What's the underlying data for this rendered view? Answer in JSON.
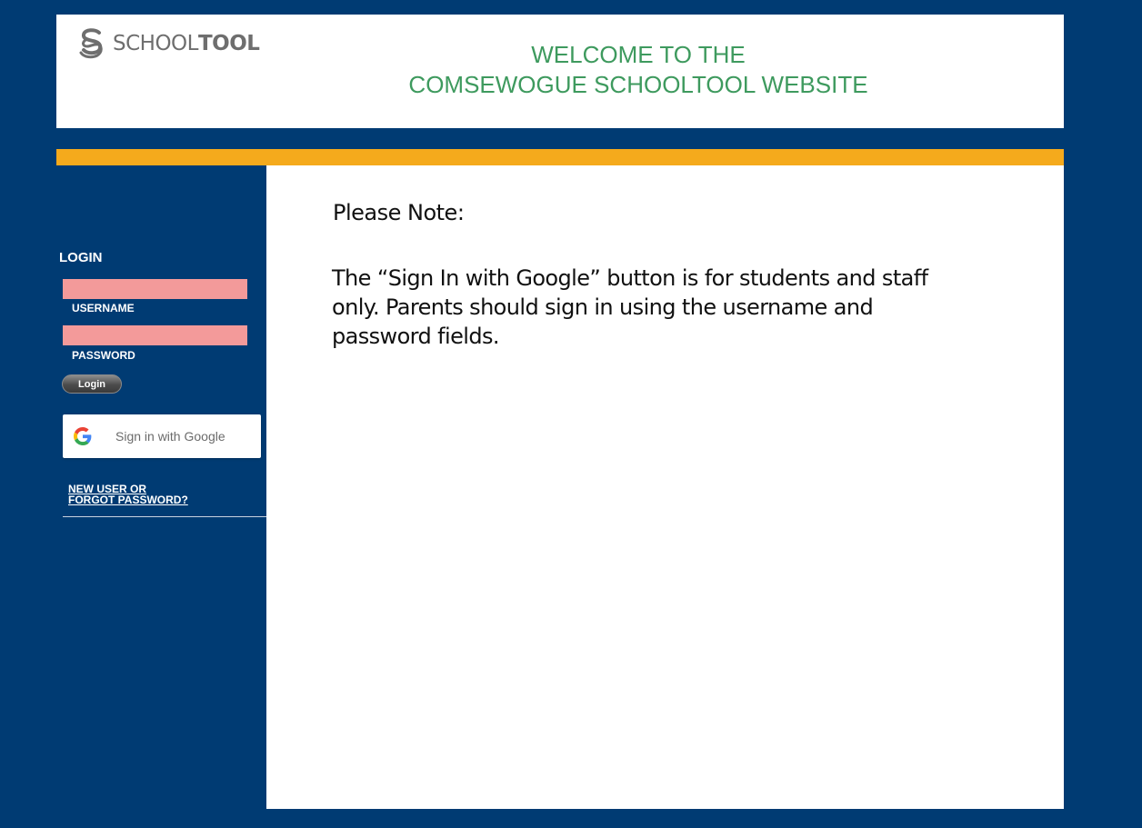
{
  "header": {
    "logo_text_light": "SCHOOL",
    "logo_text_bold": "TOOL",
    "welcome_line1": "WELCOME TO THE",
    "welcome_line2": "COMSEWOGUE SCHOOLTOOL WEBSITE"
  },
  "sidebar": {
    "login_title": "LOGIN",
    "username_label": "USERNAME",
    "username_value": "",
    "password_label": "PASSWORD",
    "password_value": "",
    "login_button": "Login",
    "google_button": "Sign in with Google",
    "new_user_line1": "NEW USER OR",
    "new_user_line2": "FORGOT PASSWORD?"
  },
  "content": {
    "note_title": "Please Note:",
    "note_line1": "The “Sign In with Google” button is for students and staff",
    "note_line2": "only. Parents should sign in using the username and",
    "note_line3": "password fields."
  },
  "colors": {
    "navy": "#003b73",
    "gold": "#f5aa1c",
    "welcome_green": "#3e9a5e",
    "field_pink": "#f39a9a"
  },
  "icons": {
    "logo": "schooltool-s-logo-icon",
    "google": "google-g-icon"
  }
}
